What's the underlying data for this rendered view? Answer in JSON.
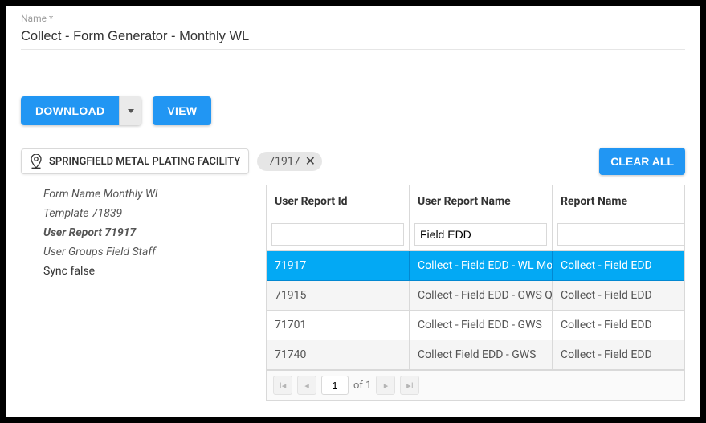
{
  "name_field": {
    "label": "Name *",
    "value": "Collect - Form Generator - Monthly WL"
  },
  "actions": {
    "download_label": "DOWNLOAD",
    "view_label": "VIEW"
  },
  "filters": {
    "facility_label": "SPRINGFIELD METAL PLATING FACILITY",
    "active_pill": "71917",
    "clear_all_label": "CLEAR ALL"
  },
  "meta": {
    "form_name": "Form Name Monthly WL",
    "template": "Template 71839",
    "user_report": "User Report 71917",
    "user_groups": "User Groups Field Staff",
    "sync": "Sync false"
  },
  "grid": {
    "columns": [
      "User Report Id",
      "User Report Name",
      "Report Name"
    ],
    "filters": {
      "col0": "",
      "col1": "Field EDD",
      "col2": ""
    },
    "rows": [
      {
        "id": "71917",
        "user_report_name": "Collect - Field EDD - WL Monthly",
        "report_name": "Collect - Field EDD",
        "selected": true
      },
      {
        "id": "71915",
        "user_report_name": "Collect - Field EDD - GWS Quarterly",
        "report_name": "Collect - Field EDD",
        "selected": false
      },
      {
        "id": "71701",
        "user_report_name": "Collect - Field EDD - GWS",
        "report_name": "Collect - Field EDD",
        "selected": false
      },
      {
        "id": "71740",
        "user_report_name": "Collect Field EDD - GWS",
        "report_name": "Collect - Field EDD",
        "selected": false
      }
    ],
    "pager": {
      "page": "1",
      "of_label": "of 1"
    }
  }
}
